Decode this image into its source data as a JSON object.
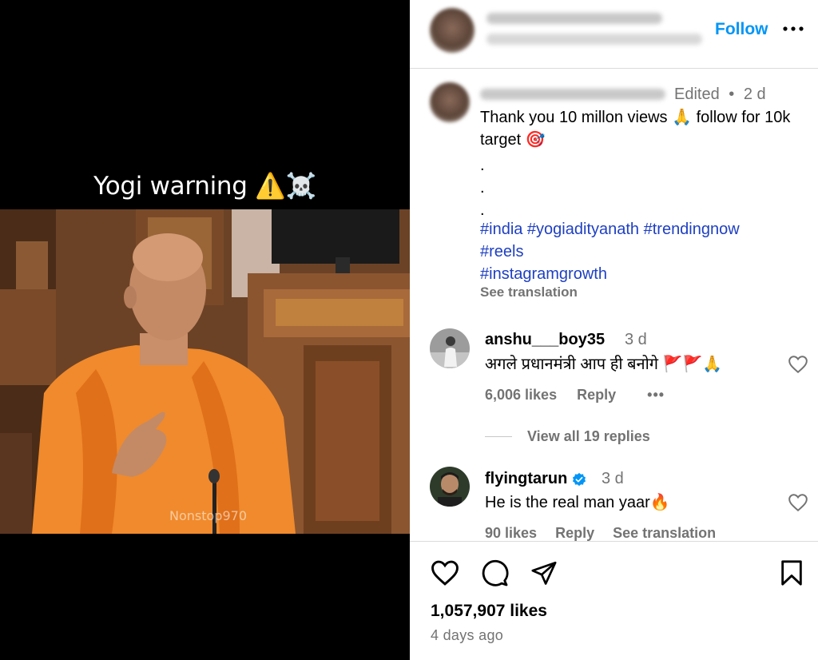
{
  "media": {
    "caption_text": "Yogi warning",
    "caption_emojis": "⚠️☠️",
    "watermark": "Nonstop970"
  },
  "header": {
    "follow_label": "Follow",
    "more_label": "•••"
  },
  "caption": {
    "edited": "Edited",
    "separator": "•",
    "time": "2 d",
    "text": "Thank you 10 millon views 🙏 follow for 10k target 🎯",
    "dots": [
      ".",
      ".",
      "."
    ],
    "hashtags": [
      "#india #yogiadityanath #trendingnow",
      "#reels",
      "#instagramgrowth"
    ],
    "see_translation": "See translation"
  },
  "comments": [
    {
      "username": "anshu___boy35",
      "time": "3 d",
      "text": "अगले प्रधानमंत्री आप ही बनोगे 🚩🚩🙏",
      "likes": "6,006 likes",
      "reply": "Reply",
      "more": "•••"
    },
    {
      "username": "flyingtarun",
      "time": "3 d",
      "text": "He is the real man yaar🔥",
      "likes": "90 likes",
      "reply": "Reply",
      "see_translation": "See translation"
    }
  ],
  "replies": {
    "label": "View all 19 replies"
  },
  "footer": {
    "likes_total": "1,057,907 likes",
    "time_ago": "4 days ago"
  },
  "colors": {
    "link_blue": "#0095f6",
    "hashtag_blue": "#1e3fc2",
    "verified_blue": "#0095f6",
    "muted_gray": "#737373",
    "saffron": "#f28a2e"
  }
}
